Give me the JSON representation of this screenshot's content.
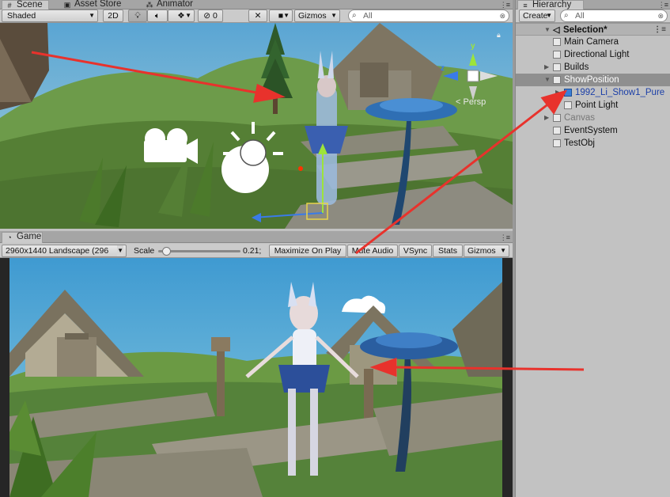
{
  "scene_tabs": [
    {
      "label": "Scene",
      "icon": "scene-hash-icon"
    },
    {
      "label": "Asset Store",
      "icon": "store-bag-icon"
    },
    {
      "label": "Animator",
      "icon": "animator-icon"
    }
  ],
  "scene_toolbar": {
    "shading_mode": "Shaded",
    "mode_2d": "2D",
    "hidden_count": "0",
    "gizmos": "Gizmos",
    "search_placeholder": "All"
  },
  "scene_overlay": {
    "projection": "Persp",
    "gizmo_axes": [
      "y",
      "z"
    ]
  },
  "game_tab": {
    "label": "Game",
    "icon": "game-pacman-icon"
  },
  "game_toolbar": {
    "resolution": "2960x1440 Landscape (296",
    "scale_label": "Scale",
    "scale_value": "0.21;",
    "scale_fraction": 0.05,
    "maximize_on_play": "Maximize On Play",
    "mute_audio": "Mute Audio",
    "vsync": "VSync",
    "stats": "Stats",
    "gizmos": "Gizmos"
  },
  "hierarchy": {
    "tab_label": "Hierarchy",
    "create_label": "Create",
    "search_placeholder": "All",
    "scene_name": "Selection*",
    "items": [
      {
        "label": "Main Camera",
        "depth": 1,
        "foldout": "none",
        "state": "normal"
      },
      {
        "label": "Directional Light",
        "depth": 1,
        "foldout": "none",
        "state": "normal"
      },
      {
        "label": "Builds",
        "depth": 1,
        "foldout": "collapsed",
        "state": "normal"
      },
      {
        "label": "ShowPosition",
        "depth": 1,
        "foldout": "expanded",
        "state": "selected"
      },
      {
        "label": "1992_Li_Show1_Pure",
        "depth": 2,
        "foldout": "collapsed",
        "state": "prefab"
      },
      {
        "label": "Point Light",
        "depth": 2,
        "foldout": "none",
        "state": "normal"
      },
      {
        "label": "Canvas",
        "depth": 1,
        "foldout": "collapsed",
        "state": "inactive"
      },
      {
        "label": "EventSystem",
        "depth": 1,
        "foldout": "none",
        "state": "normal"
      },
      {
        "label": "TestObj",
        "depth": 1,
        "foldout": "none",
        "state": "normal"
      }
    ]
  },
  "colors": {
    "annotation_arrow": "#e8322c",
    "prefab_text": "#1b3fa8",
    "selection_row": "#8f8f8f",
    "sky": "#4aa0cf",
    "grass": "#5c8a3a"
  }
}
